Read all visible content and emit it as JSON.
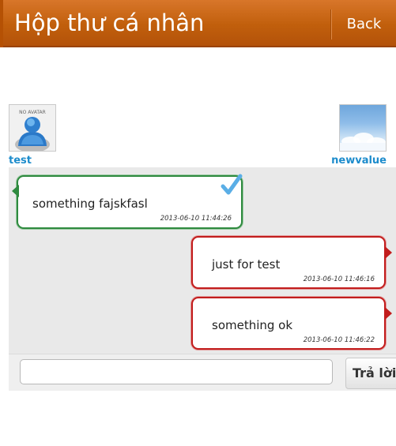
{
  "header": {
    "title": "Hộp thư cá nhân",
    "back_label": "Back"
  },
  "participants": {
    "left": {
      "name": "test",
      "avatar_icon": "no-avatar-person-icon",
      "avatar_caption": "NO AVATAR"
    },
    "right": {
      "name": "newvalue",
      "avatar_icon": "sky-clouds-avatar-icon"
    }
  },
  "messages": [
    {
      "text": "something fajskfasl",
      "time": "2013-06-10 11:44:26",
      "side": "left",
      "read_icon": "checkmark-icon",
      "border_color": "#2f8a3f"
    },
    {
      "text": "just for test",
      "time": "2013-06-10 11:46:16",
      "side": "right",
      "border_color": "#c21d1d"
    },
    {
      "text": "something ok",
      "time": "2013-06-10 11:46:22",
      "side": "right",
      "border_color": "#c21d1d"
    }
  ],
  "reply": {
    "placeholder": "",
    "button_label": "Trả lời"
  },
  "colors": {
    "header": "#c15f0c",
    "username": "#1d8ccc",
    "chat_background": "#e9e9e9"
  }
}
